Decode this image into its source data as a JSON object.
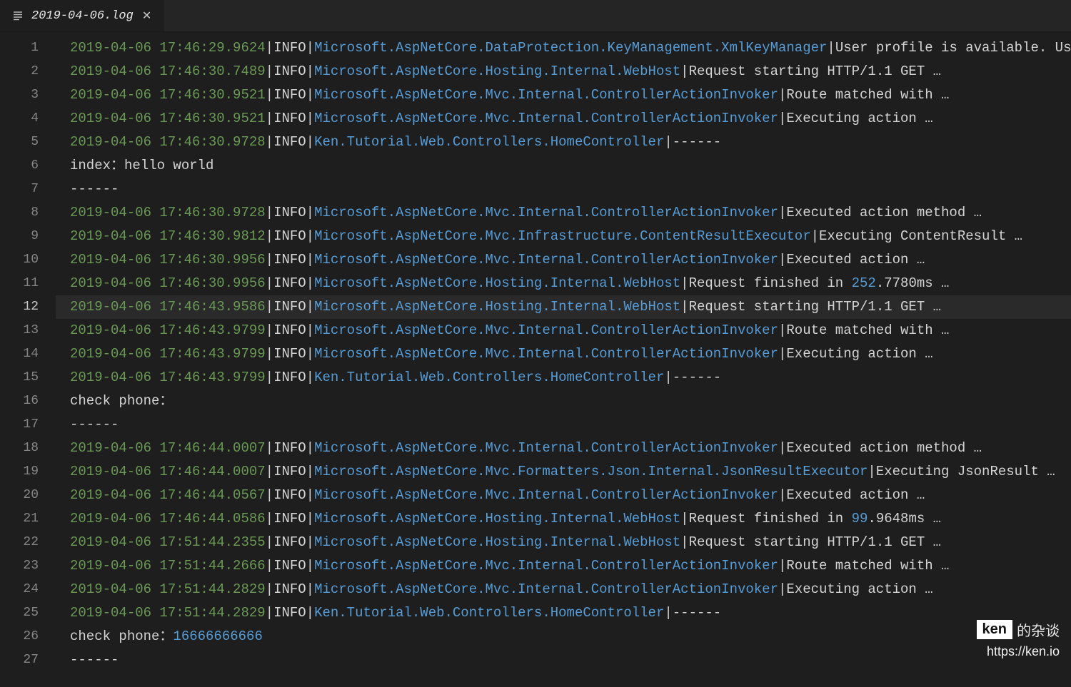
{
  "tab": {
    "title": "2019-04-06.log"
  },
  "activeLine": 12,
  "watermark": {
    "name": "ken",
    "suffix": "的杂谈",
    "url": "https://ken.io"
  },
  "lines": [
    {
      "n": 1,
      "type": "log",
      "ts": "2019-04-06 17:46:29.9624",
      "lv": "INFO",
      "ns": "Microsoft.AspNetCore.DataProtection.KeyManagement.XmlKeyManager",
      "msg": "User profile is available. Using …"
    },
    {
      "n": 2,
      "type": "log",
      "ts": "2019-04-06 17:46:30.7489",
      "lv": "INFO",
      "ns": "Microsoft.AspNetCore.Hosting.Internal.WebHost",
      "msg": "Request starting HTTP/1.1 GET …"
    },
    {
      "n": 3,
      "type": "log",
      "ts": "2019-04-06 17:46:30.9521",
      "lv": "INFO",
      "ns": "Microsoft.AspNetCore.Mvc.Internal.ControllerActionInvoker",
      "msg": "Route matched with …"
    },
    {
      "n": 4,
      "type": "log",
      "ts": "2019-04-06 17:46:30.9521",
      "lv": "INFO",
      "ns": "Microsoft.AspNetCore.Mvc.Internal.ControllerActionInvoker",
      "msg": "Executing action …"
    },
    {
      "n": 5,
      "type": "log",
      "ts": "2019-04-06 17:46:30.9728",
      "lv": "INFO",
      "ns": "Ken.Tutorial.Web.Controllers.HomeController",
      "msg": "------"
    },
    {
      "n": 6,
      "type": "plain",
      "text": "index：hello world"
    },
    {
      "n": 7,
      "type": "plain",
      "text": "------"
    },
    {
      "n": 8,
      "type": "log",
      "ts": "2019-04-06 17:46:30.9728",
      "lv": "INFO",
      "ns": "Microsoft.AspNetCore.Mvc.Internal.ControllerActionInvoker",
      "msg": "Executed action method …"
    },
    {
      "n": 9,
      "type": "log",
      "ts": "2019-04-06 17:46:30.9812",
      "lv": "INFO",
      "ns": "Microsoft.AspNetCore.Mvc.Infrastructure.ContentResultExecutor",
      "msg": "Executing ContentResult …"
    },
    {
      "n": 10,
      "type": "log",
      "ts": "2019-04-06 17:46:30.9956",
      "lv": "INFO",
      "ns": "Microsoft.AspNetCore.Mvc.Internal.ControllerActionInvoker",
      "msg": "Executed action …"
    },
    {
      "n": 11,
      "type": "lognum",
      "ts": "2019-04-06 17:46:30.9956",
      "lv": "INFO",
      "ns": "Microsoft.AspNetCore.Hosting.Internal.WebHost",
      "msgPre": "Request finished in ",
      "num": "252",
      "msgPost": ".7780ms …"
    },
    {
      "n": 12,
      "type": "log",
      "ts": "2019-04-06 17:46:43.9586",
      "lv": "INFO",
      "ns": "Microsoft.AspNetCore.Hosting.Internal.WebHost",
      "msg": "Request starting HTTP/1.1 GET …"
    },
    {
      "n": 13,
      "type": "log",
      "ts": "2019-04-06 17:46:43.9799",
      "lv": "INFO",
      "ns": "Microsoft.AspNetCore.Mvc.Internal.ControllerActionInvoker",
      "msg": "Route matched with …"
    },
    {
      "n": 14,
      "type": "log",
      "ts": "2019-04-06 17:46:43.9799",
      "lv": "INFO",
      "ns": "Microsoft.AspNetCore.Mvc.Internal.ControllerActionInvoker",
      "msg": "Executing action …"
    },
    {
      "n": 15,
      "type": "log",
      "ts": "2019-04-06 17:46:43.9799",
      "lv": "INFO",
      "ns": "Ken.Tutorial.Web.Controllers.HomeController",
      "msg": "------"
    },
    {
      "n": 16,
      "type": "plain",
      "text": "check phone："
    },
    {
      "n": 17,
      "type": "plain",
      "text": "------"
    },
    {
      "n": 18,
      "type": "log",
      "ts": "2019-04-06 17:46:44.0007",
      "lv": "INFO",
      "ns": "Microsoft.AspNetCore.Mvc.Internal.ControllerActionInvoker",
      "msg": "Executed action method …"
    },
    {
      "n": 19,
      "type": "log",
      "ts": "2019-04-06 17:46:44.0007",
      "lv": "INFO",
      "ns": "Microsoft.AspNetCore.Mvc.Formatters.Json.Internal.JsonResultExecutor",
      "msg": "Executing JsonResult …"
    },
    {
      "n": 20,
      "type": "log",
      "ts": "2019-04-06 17:46:44.0567",
      "lv": "INFO",
      "ns": "Microsoft.AspNetCore.Mvc.Internal.ControllerActionInvoker",
      "msg": "Executed action …"
    },
    {
      "n": 21,
      "type": "lognum",
      "ts": "2019-04-06 17:46:44.0586",
      "lv": "INFO",
      "ns": "Microsoft.AspNetCore.Hosting.Internal.WebHost",
      "msgPre": "Request finished in ",
      "num": "99",
      "msgPost": ".9648ms …"
    },
    {
      "n": 22,
      "type": "log",
      "ts": "2019-04-06 17:51:44.2355",
      "lv": "INFO",
      "ns": "Microsoft.AspNetCore.Hosting.Internal.WebHost",
      "msg": "Request starting HTTP/1.1 GET …"
    },
    {
      "n": 23,
      "type": "log",
      "ts": "2019-04-06 17:51:44.2666",
      "lv": "INFO",
      "ns": "Microsoft.AspNetCore.Mvc.Internal.ControllerActionInvoker",
      "msg": "Route matched with …"
    },
    {
      "n": 24,
      "type": "log",
      "ts": "2019-04-06 17:51:44.2829",
      "lv": "INFO",
      "ns": "Microsoft.AspNetCore.Mvc.Internal.ControllerActionInvoker",
      "msg": "Executing action …"
    },
    {
      "n": 25,
      "type": "log",
      "ts": "2019-04-06 17:51:44.2829",
      "lv": "INFO",
      "ns": "Ken.Tutorial.Web.Controllers.HomeController",
      "msg": "------"
    },
    {
      "n": 26,
      "type": "plainnum",
      "textPre": "check phone：",
      "num": "16666666666"
    },
    {
      "n": 27,
      "type": "plain",
      "text": "------"
    }
  ]
}
